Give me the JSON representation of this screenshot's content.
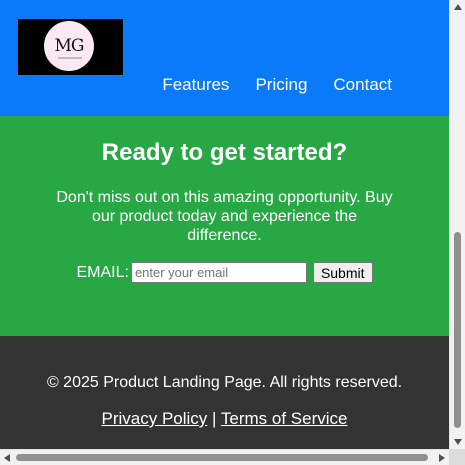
{
  "colors": {
    "header_bg": "#0a7af8",
    "cta_bg": "#28a745",
    "footer_bg": "#333333",
    "text_light": "#ffffff"
  },
  "header": {
    "logo_text": "MG",
    "logo_icon": "mg-logo-icon",
    "nav": [
      {
        "label": "Features"
      },
      {
        "label": "Pricing"
      },
      {
        "label": "Contact"
      }
    ]
  },
  "cta": {
    "title": "Ready to get started?",
    "text": "Don't miss out on this amazing opportunity. Buy our product today and experience the difference.",
    "email_label": "EMAIL:",
    "email_placeholder": "enter your email",
    "email_value": "",
    "submit_label": "Submit"
  },
  "footer": {
    "copyright": "© 2025 Product Landing Page. All rights reserved.",
    "links": [
      {
        "label": "Privacy Policy"
      },
      {
        "label": "Terms of Service"
      }
    ],
    "separator": "|"
  }
}
